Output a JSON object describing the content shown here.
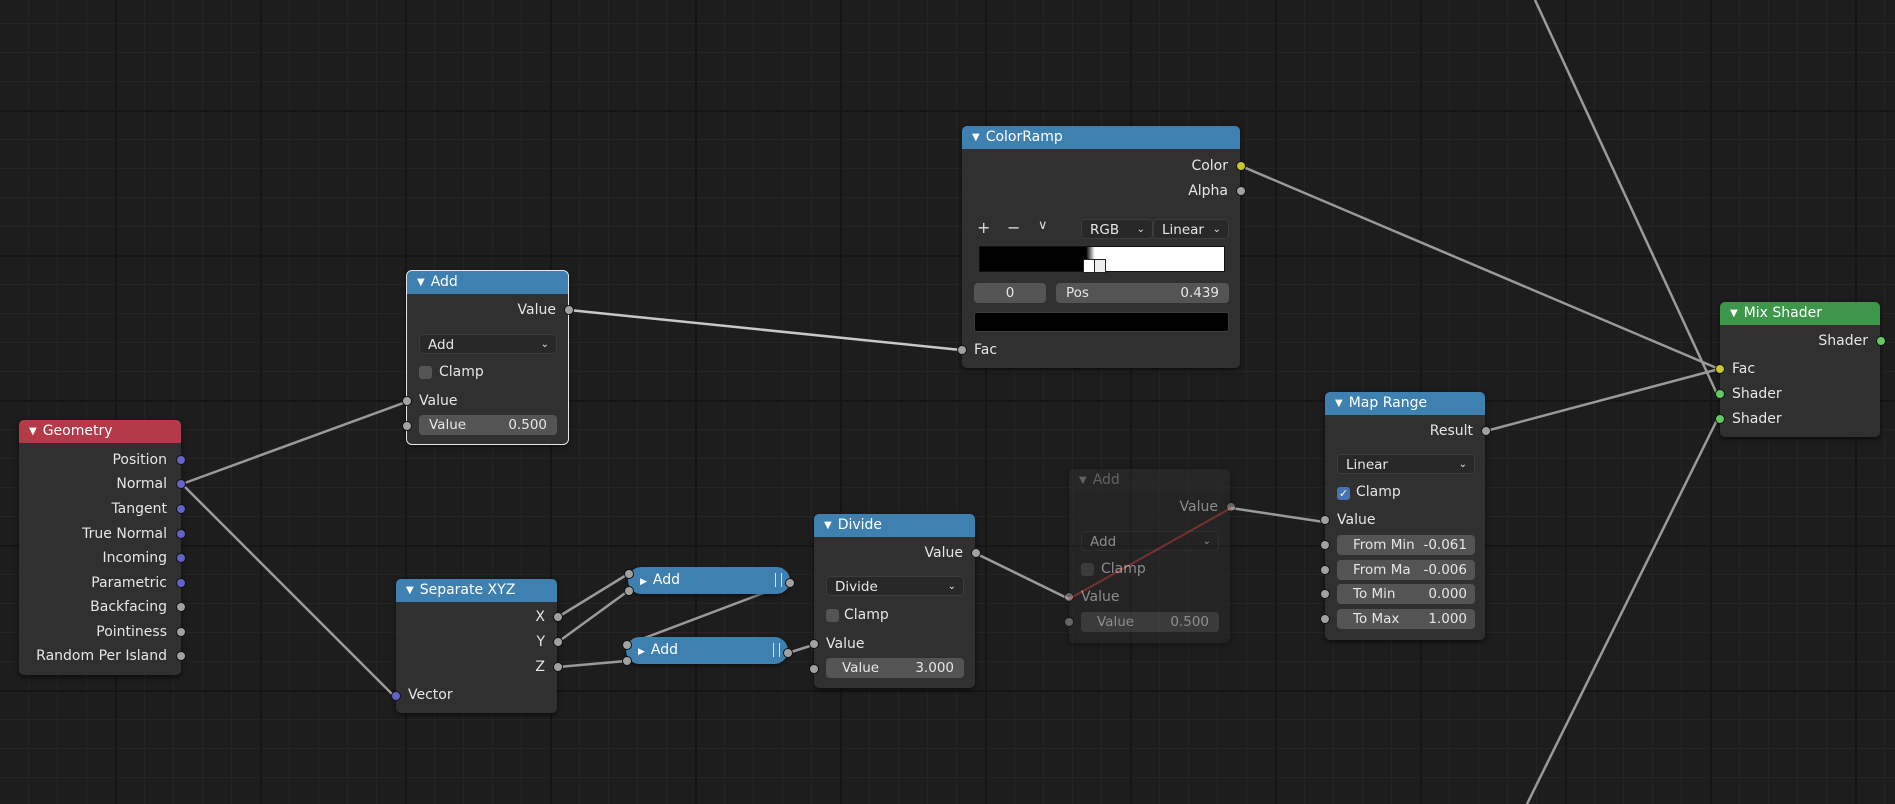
{
  "geometry": {
    "title": "Geometry",
    "outputs": [
      "Position",
      "Normal",
      "Tangent",
      "True Normal",
      "Incoming",
      "Parametric",
      "Backfacing",
      "Pointiness",
      "Random Per Island"
    ]
  },
  "add_top": {
    "title": "Add",
    "output": "Value",
    "operation": "Add",
    "clamp_label": "Clamp",
    "input_label": "Value",
    "field_label": "Value",
    "field_value": "0.500"
  },
  "colorramp": {
    "title": "ColorRamp",
    "out_color": "Color",
    "out_alpha": "Alpha",
    "plus": "+",
    "minus": "−",
    "menu": "∨",
    "color_mode": "RGB",
    "interpolation": "Linear",
    "index": "0",
    "pos_label": "Pos",
    "pos_value": "0.439",
    "input_label": "Fac"
  },
  "mix_shader": {
    "title": "Mix Shader",
    "output": "Shader",
    "in_fac": "Fac",
    "in_shader1": "Shader",
    "in_shader2": "Shader"
  },
  "map_range": {
    "title": "Map Range",
    "output": "Result",
    "interpolation": "Linear",
    "clamp_label": "Clamp",
    "input_label": "Value",
    "from_min_label": "From Min",
    "from_min_value": "-0.061",
    "from_max_label": "From Ma",
    "from_max_value": "-0.006",
    "to_min_label": "To Min",
    "to_min_value": "0.000",
    "to_max_label": "To Max",
    "to_max_value": "1.000"
  },
  "add_muted": {
    "title": "Add",
    "output": "Value",
    "operation": "Add",
    "clamp_label": "Clamp",
    "input_label": "Value",
    "field_label": "Value",
    "field_value": "0.500"
  },
  "divide": {
    "title": "Divide",
    "output": "Value",
    "operation": "Divide",
    "clamp_label": "Clamp",
    "input_label": "Value",
    "field_label": "Value",
    "field_value": "3.000"
  },
  "separate_xyz": {
    "title": "Separate XYZ",
    "out_x": "X",
    "out_y": "Y",
    "out_z": "Z",
    "input_label": "Vector"
  },
  "collapsed_add_1": {
    "title": "Add"
  },
  "collapsed_add_2": {
    "title": "Add"
  },
  "colors": {
    "header_blue": "#3e80b0",
    "header_red": "#b43a4a",
    "header_green": "#3d9649",
    "socket_gray": "#a1a1a1",
    "socket_blue": "#6363c7",
    "socket_yellow": "#c7c729",
    "socket_green": "#63c763",
    "wire_red": "#d23c3c"
  }
}
